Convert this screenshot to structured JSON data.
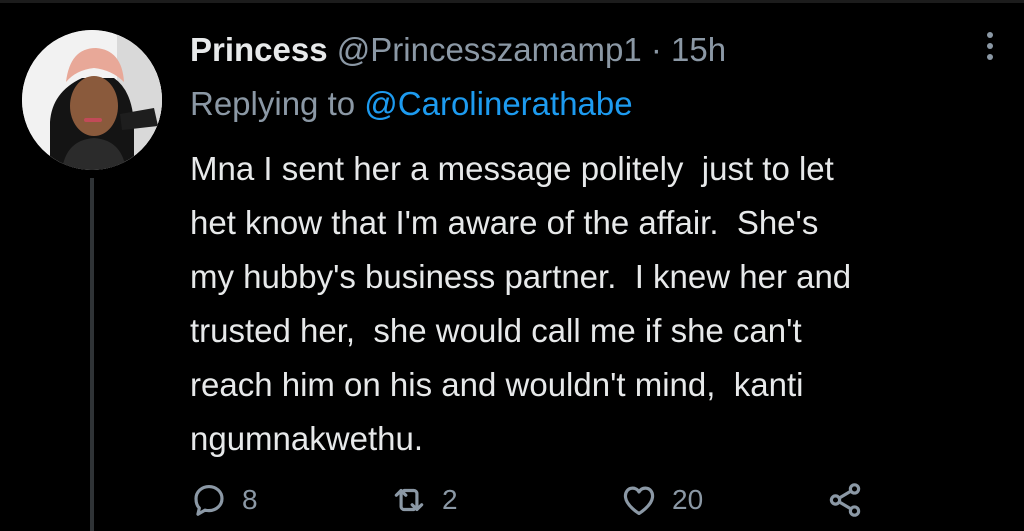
{
  "tweet": {
    "author_name": "Princess",
    "author_handle": "@Princesszamamp1",
    "separator": "·",
    "time": "15h",
    "replying_prefix": "Replying to",
    "replying_handle": "@Carolinerathabe",
    "body_lines": [
      "Mna I sent her a message politely  just to let",
      "het know that I'm aware of the affair.  She's",
      "my hubby's business partner.  I knew her and",
      "trusted her,  she would call me if she can't",
      "reach him on his and wouldn't mind,  kanti",
      "ngumnakwethu."
    ],
    "reply_count": "8",
    "retweet_count": "2",
    "like_count": "20"
  },
  "icons": {
    "more": "more-vertical-icon",
    "reply": "reply-bubble-icon",
    "retweet": "retweet-icon",
    "like": "heart-icon",
    "share": "share-icon"
  },
  "colors": {
    "background": "#000000",
    "primary_text": "#e7e9ea",
    "secondary_text": "#8b98a5",
    "link": "#1d9bf0"
  }
}
